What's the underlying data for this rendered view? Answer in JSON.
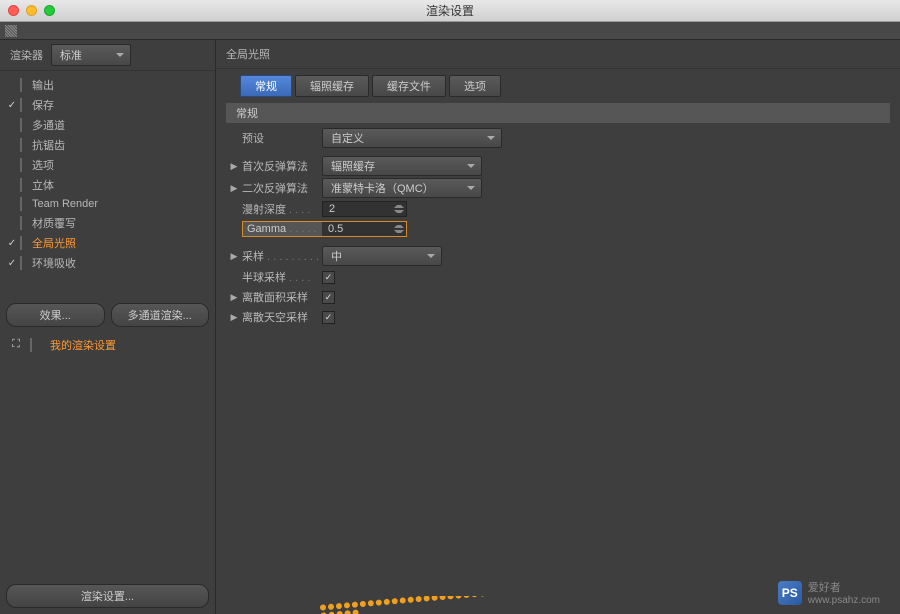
{
  "window": {
    "title": "渲染设置"
  },
  "renderer": {
    "label": "渲染器",
    "value": "标准"
  },
  "categories": [
    {
      "label": "输出",
      "checked": false
    },
    {
      "label": "保存",
      "checked": true
    },
    {
      "label": "多通道",
      "checked": false
    },
    {
      "label": "抗锯齿",
      "checked": null
    },
    {
      "label": "选项",
      "checked": null
    },
    {
      "label": "立体",
      "checked": false
    },
    {
      "label": "Team Render",
      "checked": null
    },
    {
      "label": "材质覆写",
      "checked": false
    },
    {
      "label": "全局光照",
      "checked": true,
      "active": true
    },
    {
      "label": "环境吸收",
      "checked": true
    }
  ],
  "buttons": {
    "effect": "效果...",
    "multipass": "多通道渲染...",
    "myPreset": "我的渲染设置",
    "renderSettings": "渲染设置..."
  },
  "panel": {
    "title": "全局光照",
    "tabs": [
      {
        "label": "常规",
        "active": true
      },
      {
        "label": "辐照缓存",
        "active": false
      },
      {
        "label": "缓存文件",
        "active": false
      },
      {
        "label": "选项",
        "active": false
      }
    ],
    "section": "常规",
    "preset": {
      "label": "预设",
      "value": "自定义"
    },
    "primary": {
      "label": "首次反弹算法",
      "value": "辐照缓存"
    },
    "secondary": {
      "label": "二次反弹算法",
      "value": "准蒙特卡洛（QMC）"
    },
    "diffuseDepth": {
      "label": "漫射深度",
      "value": "2"
    },
    "gamma": {
      "label": "Gamma",
      "value": "0.5"
    },
    "samples": {
      "label": "采样",
      "value": "中"
    },
    "hemispherical": {
      "label": "半球采样",
      "checked": true
    },
    "discreteArea": {
      "label": "离散面积采样",
      "checked": true
    },
    "discreteSky": {
      "label": "离散天空采样",
      "checked": true
    }
  },
  "watermark": {
    "logo": "PS",
    "text": "爱好者",
    "url": "www.psahz.com"
  }
}
